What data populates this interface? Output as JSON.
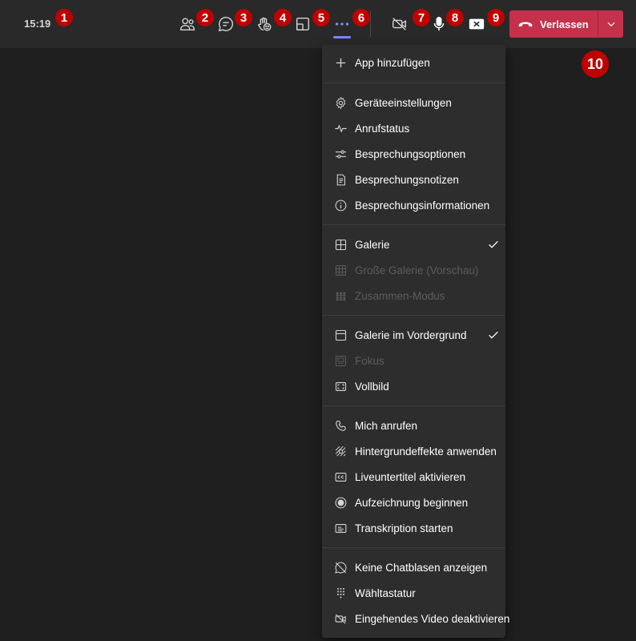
{
  "toolbar": {
    "clock": "15:19",
    "icons": [
      "participants-icon",
      "chat-icon",
      "reactions-icon",
      "share-screen-icon",
      "more-options-icon",
      "camera-off-icon",
      "microphone-icon",
      "share-tray-icon"
    ],
    "leave_label": "Verlassen",
    "leave_color": "#c4314b",
    "accent_color": "#7f85f5"
  },
  "badges": [
    "1",
    "2",
    "3",
    "4",
    "5",
    "6",
    "7",
    "8",
    "9",
    "10"
  ],
  "menu": {
    "items": [
      {
        "label": "App hinzufügen",
        "icon": "plus-icon",
        "enabled": true,
        "checked": false
      },
      {
        "label": "Geräteeinstellungen",
        "icon": "gear-icon",
        "enabled": true,
        "checked": false
      },
      {
        "label": "Anrufstatus",
        "icon": "pulse-icon",
        "enabled": true,
        "checked": false
      },
      {
        "label": "Besprechungsoptionen",
        "icon": "sliders-icon",
        "enabled": true,
        "checked": false
      },
      {
        "label": "Besprechungsnotizen",
        "icon": "notes-icon",
        "enabled": true,
        "checked": false
      },
      {
        "label": "Besprechungsinformationen",
        "icon": "info-icon",
        "enabled": true,
        "checked": false
      },
      {
        "label": "Galerie",
        "icon": "gallery-icon",
        "enabled": true,
        "checked": true
      },
      {
        "label": "Große Galerie (Vorschau)",
        "icon": "large-gallery-icon",
        "enabled": false,
        "checked": false
      },
      {
        "label": "Zusammen-Modus",
        "icon": "together-mode-icon",
        "enabled": false,
        "checked": false
      },
      {
        "label": "Galerie im Vordergrund",
        "icon": "gallery-top-icon",
        "enabled": true,
        "checked": true
      },
      {
        "label": "Fokus",
        "icon": "focus-icon",
        "enabled": false,
        "checked": false
      },
      {
        "label": "Vollbild",
        "icon": "fullscreen-icon",
        "enabled": true,
        "checked": false
      },
      {
        "label": "Mich anrufen",
        "icon": "phone-icon",
        "enabled": true,
        "checked": false
      },
      {
        "label": "Hintergrundeffekte anwenden",
        "icon": "background-effects-icon",
        "enabled": true,
        "checked": false
      },
      {
        "label": "Liveuntertitel aktivieren",
        "icon": "captions-icon",
        "enabled": true,
        "checked": false
      },
      {
        "label": "Aufzeichnung beginnen",
        "icon": "record-icon",
        "enabled": true,
        "checked": false
      },
      {
        "label": "Transkription starten",
        "icon": "transcript-icon",
        "enabled": true,
        "checked": false
      },
      {
        "label": "Keine Chatblasen anzeigen",
        "icon": "chat-bubbles-off-icon",
        "enabled": true,
        "checked": false
      },
      {
        "label": "Wähltastatur",
        "icon": "dialpad-icon",
        "enabled": true,
        "checked": false
      },
      {
        "label": "Eingehendes Video deaktivieren",
        "icon": "video-off-icon",
        "enabled": true,
        "checked": false
      }
    ]
  }
}
